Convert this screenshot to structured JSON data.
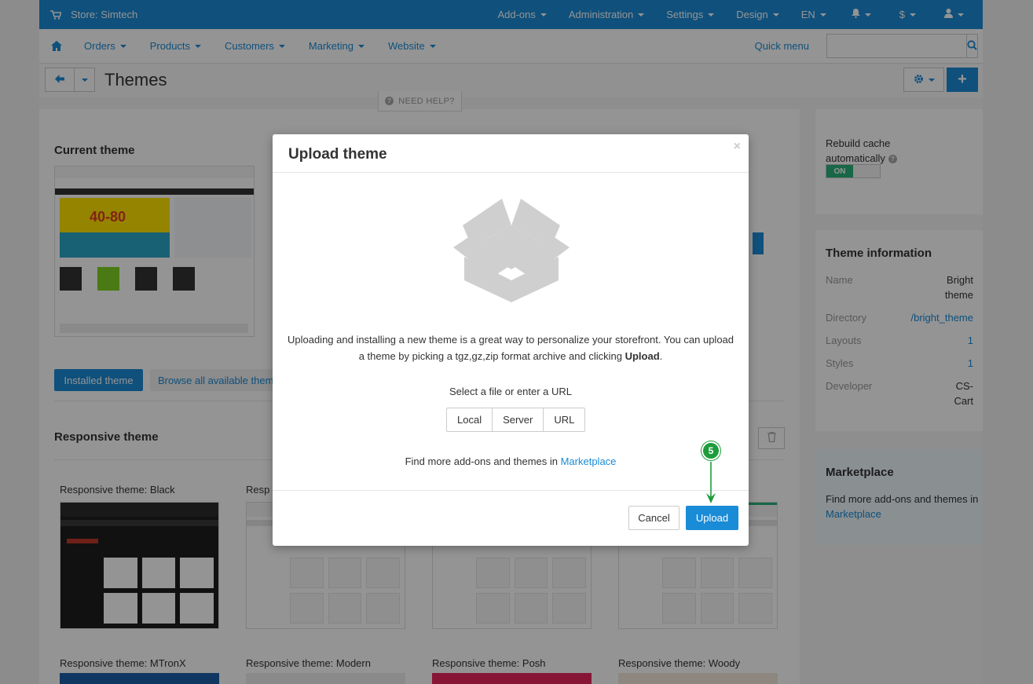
{
  "topbar": {
    "store": "Store: Simtech",
    "menu": [
      "Add-ons",
      "Administration",
      "Settings",
      "Design",
      "EN"
    ],
    "currency": "$"
  },
  "mainnav": {
    "items": [
      "Orders",
      "Products",
      "Customers",
      "Marketing",
      "Website"
    ],
    "quick_menu": "Quick menu",
    "search_placeholder": ""
  },
  "page": {
    "title": "Themes",
    "need_help": "NEED HELP?"
  },
  "content": {
    "current_theme_heading": "Current theme",
    "current_banner": "40-80",
    "tabs": [
      "Installed theme",
      "Browse all available them"
    ],
    "responsive_heading": "Responsive theme",
    "themes_row1": [
      "Responsive theme: Black",
      "Resp"
    ],
    "themes_row2": [
      "Responsive theme: MTronX",
      "Responsive theme: Modern",
      "Responsive theme: Posh",
      "Responsive theme: Woody"
    ]
  },
  "sidebar": {
    "cache_label_1": "Rebuild cache",
    "cache_label_2": "automatically",
    "toggle_on": "ON",
    "info_heading": "Theme information",
    "info": [
      {
        "k": "Name",
        "v1": "Bright",
        "v2": "theme"
      },
      {
        "k": "Directory",
        "v1": "/bright_theme",
        "v2": ""
      },
      {
        "k": "Layouts",
        "v1": "1",
        "v2": ""
      },
      {
        "k": "Styles",
        "v1": "1",
        "v2": ""
      },
      {
        "k": "Developer",
        "v1": "CS-",
        "v2": "Cart"
      }
    ],
    "marketplace_heading": "Marketplace",
    "marketplace_text": "Find more add-ons and themes in",
    "marketplace_link": "Marketplace"
  },
  "modal": {
    "title": "Upload theme",
    "close": "×",
    "desc_1": "Uploading and installing a new theme is a great way to personalize your storefront. You can upload a theme by picking a tgz,gz,zip format archive and clicking ",
    "desc_bold": "Upload",
    "desc_end": ".",
    "select_label": "Select a file or enter a URL",
    "sources": [
      "Local",
      "Server",
      "URL"
    ],
    "more_text": "Find more add-ons and themes in ",
    "more_link": "Marketplace",
    "cancel": "Cancel",
    "upload": "Upload"
  },
  "step_marker": "5",
  "colors": {
    "accent": "#1a8bd6",
    "toggle_on": "#2ab27b",
    "step": "#1e9c3c"
  }
}
